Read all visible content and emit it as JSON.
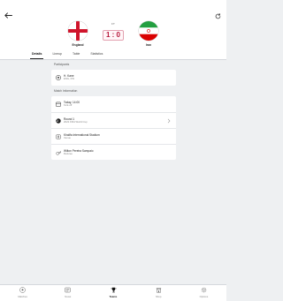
{
  "match": {
    "status": "FT",
    "score": "1 : 0",
    "home": {
      "name": "England"
    },
    "away": {
      "name": "Iran"
    }
  },
  "tabs": [
    {
      "label": "Details",
      "active": true
    },
    {
      "label": "Lineup",
      "active": false
    },
    {
      "label": "Table",
      "active": false
    },
    {
      "label": "Statistics",
      "active": false
    }
  ],
  "participants": {
    "label": "Participants",
    "items": [
      {
        "title": "H. Kane",
        "subtitle": "ENG, FW",
        "icon": "soccer-ball-icon"
      }
    ]
  },
  "match_info": {
    "label": "Match Information",
    "items": [
      {
        "title": "Today, 14:00",
        "subtitle": "Kick-off",
        "icon": "calendar-icon"
      },
      {
        "title": "Round 1",
        "subtitle": "2022 FIFA World Cup",
        "icon": "trophy-ball-icon",
        "chevron": true
      },
      {
        "title": "Khalifa International Stadium",
        "subtitle": "Venue",
        "icon": "stadium-icon"
      },
      {
        "title": "Wilton Pereira Sampaio",
        "subtitle": "Referee",
        "icon": "whistle-icon"
      }
    ]
  },
  "bottom_nav": [
    {
      "label": "Matches",
      "icon": "soccer-ball-icon",
      "active": false
    },
    {
      "label": "News",
      "icon": "news-icon",
      "active": false
    },
    {
      "label": "Teams",
      "icon": "trophy-icon",
      "active": true
    },
    {
      "label": "Shop",
      "icon": "shop-icon",
      "active": false
    },
    {
      "label": "Options",
      "icon": "gear-icon",
      "active": false
    }
  ],
  "colors": {
    "score": "#b8193c",
    "background": "#eef0f2"
  }
}
